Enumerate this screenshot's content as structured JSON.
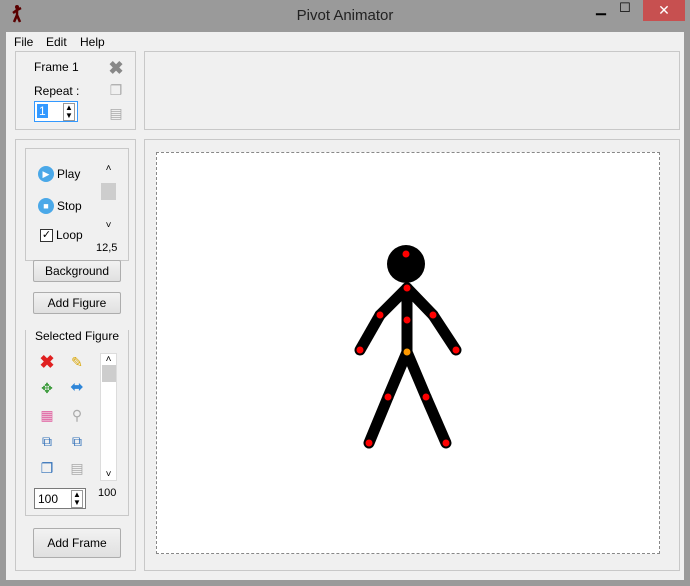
{
  "window": {
    "title": "Pivot Animator",
    "minimize": "▁",
    "maximize": "☐",
    "close": "✕"
  },
  "menu": [
    "File",
    "Edit",
    "Help"
  ],
  "frame": {
    "label": "Frame 1",
    "repeat_label": "Repeat :",
    "repeat_value": "1"
  },
  "playback": {
    "play": "Play",
    "stop": "Stop",
    "loop": "Loop",
    "loop_checked": true,
    "speed": "12,5"
  },
  "buttons": {
    "background": "Background",
    "add_figure": "Add Figure",
    "add_frame": "Add Frame"
  },
  "selected_figure": {
    "title": "Selected Figure",
    "scale_value": "100",
    "slider_value": "100"
  },
  "colors": {
    "close": "#c75050",
    "joint": "#ff0000",
    "hip": "#ff9900"
  }
}
